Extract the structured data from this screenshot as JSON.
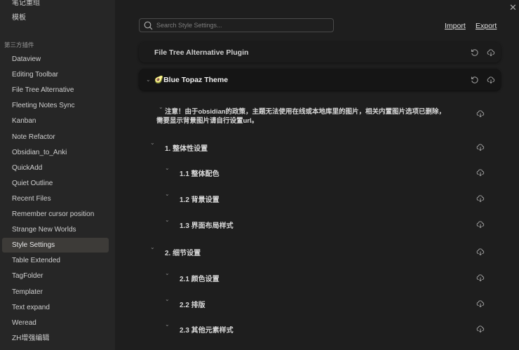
{
  "sidebar": {
    "top_items": [
      "笔记重组",
      "模板"
    ],
    "section_header": "第三方插件",
    "items": [
      "Dataview",
      "Editing Toolbar",
      "File Tree Alternative",
      "Fleeting Notes Sync",
      "Kanban",
      "Note Refactor",
      "Obsidian_to_Anki",
      "QuickAdd",
      "Quiet Outline",
      "Recent Files",
      "Remember cursor position",
      "Strange New Worlds",
      "Style Settings",
      "Table Extended",
      "TagFolder",
      "Templater",
      "Text expand",
      "Weread",
      "ZH增强编辑"
    ],
    "selected": "Style Settings"
  },
  "search": {
    "placeholder": "Search Style Settings..."
  },
  "actions": {
    "import": "Import",
    "export": "Export"
  },
  "sections": [
    {
      "title": "File Tree Alternative Plugin",
      "collapsed": true
    },
    {
      "title": "🥑Blue Topaz Theme",
      "collapsed": false
    }
  ],
  "notice": {
    "line1": "注意！由于obsidian的政策，主题无法使用在线或本地库里的图片，相关内置图片选项已删除，",
    "line2": "需要显示背景图片请自行设置url。"
  },
  "items": [
    {
      "label": "1. 整体性设置",
      "level": 1
    },
    {
      "label": "1.1 整体配色",
      "level": 2
    },
    {
      "label": "1.2 背景设置",
      "level": 2
    },
    {
      "label": "1.3 界面布局样式",
      "level": 2
    },
    {
      "label": "2. 细节设置",
      "level": 1
    },
    {
      "label": "2.1 颜色设置",
      "level": 2
    },
    {
      "label": "2.2 排版",
      "level": 2
    },
    {
      "label": "2.3 其他元素样式",
      "level": 2
    }
  ]
}
